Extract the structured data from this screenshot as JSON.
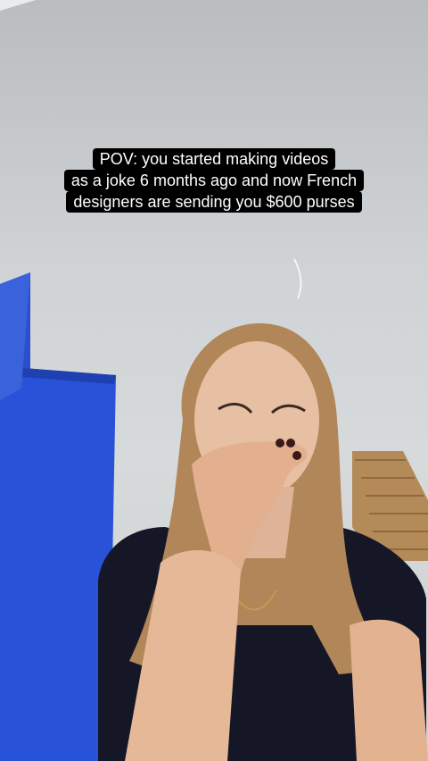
{
  "caption": {
    "lines": [
      "POV: you started making videos",
      "as a joke 6 months ago and now French",
      "designers are sending you $600 purses"
    ]
  }
}
